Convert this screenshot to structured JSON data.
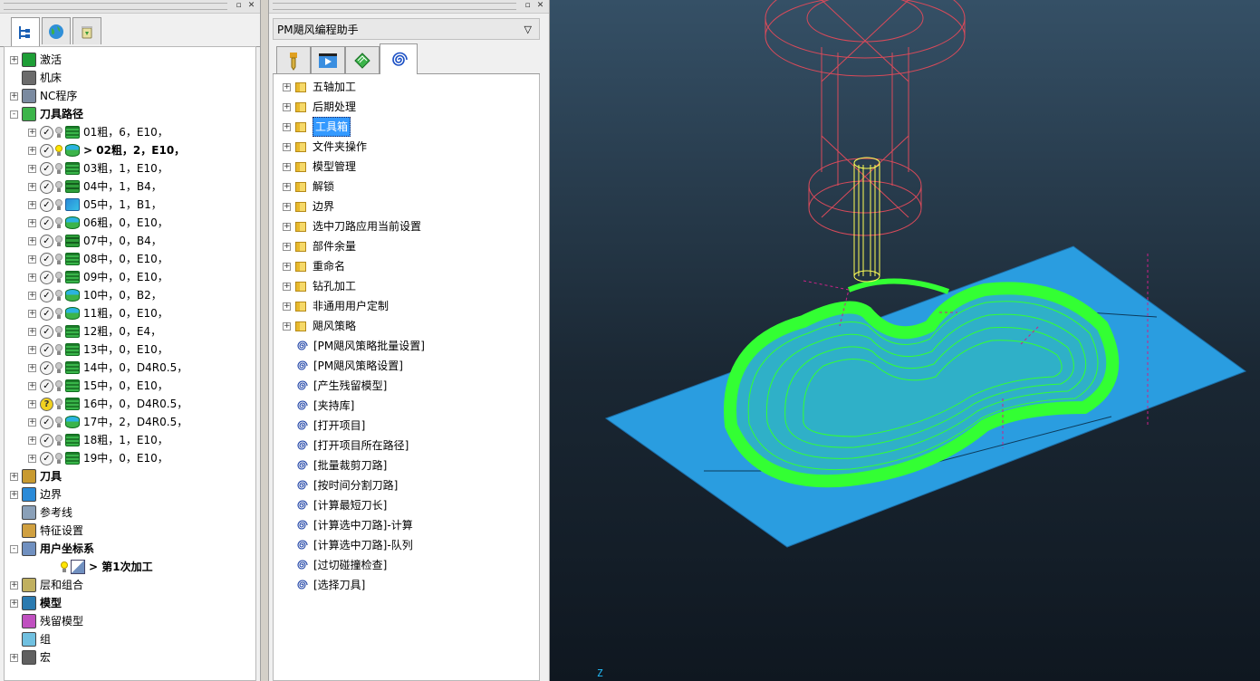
{
  "explorer": {
    "tree": [
      {
        "label": "激活",
        "bold": false,
        "icon": "activate-icon",
        "expander": "+"
      },
      {
        "label": "机床",
        "bold": false,
        "icon": "machine-icon",
        "expander": ""
      },
      {
        "label": "NC程序",
        "bold": false,
        "icon": "nc-program-icon",
        "expander": "+"
      },
      {
        "label": "刀具路径",
        "bold": true,
        "icon": "toolpaths-icon",
        "expander": "-"
      }
    ],
    "toolpaths": [
      {
        "label": "01粗，6，E10，",
        "status": "check",
        "bulb": false,
        "type": "layers",
        "active": false
      },
      {
        "label": "> 02粗，2，E10，",
        "status": "check",
        "bulb": true,
        "type": "cyl",
        "active": true
      },
      {
        "label": "03粗，1，E10，",
        "status": "check",
        "bulb": false,
        "type": "layers",
        "active": false
      },
      {
        "label": "04中，1，B4，",
        "status": "check",
        "bulb": false,
        "type": "flat",
        "active": false
      },
      {
        "label": "05中，1，B1，",
        "status": "check",
        "bulb": false,
        "type": "blue",
        "active": false
      },
      {
        "label": "06粗，0，E10，",
        "status": "check",
        "bulb": false,
        "type": "cyl",
        "active": false
      },
      {
        "label": "07中，0，B4，",
        "status": "check",
        "bulb": false,
        "type": "flat",
        "active": false
      },
      {
        "label": "08中，0，E10，",
        "status": "check",
        "bulb": false,
        "type": "layers",
        "active": false
      },
      {
        "label": "09中，0，E10，",
        "status": "check",
        "bulb": false,
        "type": "layers",
        "active": false
      },
      {
        "label": "10中，0，B2，",
        "status": "check",
        "bulb": false,
        "type": "cyl",
        "active": false
      },
      {
        "label": "11粗，0，E10，",
        "status": "check",
        "bulb": false,
        "type": "cyl",
        "active": false
      },
      {
        "label": "12粗，0，E4，",
        "status": "check",
        "bulb": false,
        "type": "layers",
        "active": false
      },
      {
        "label": "13中，0，E10，",
        "status": "check",
        "bulb": false,
        "type": "layers",
        "active": false
      },
      {
        "label": "14中，0，D4R0.5，",
        "status": "check",
        "bulb": false,
        "type": "layers",
        "active": false
      },
      {
        "label": "15中，0，E10，",
        "status": "check",
        "bulb": false,
        "type": "layers",
        "active": false
      },
      {
        "label": "16中，0，D4R0.5，",
        "status": "question",
        "bulb": false,
        "type": "layers",
        "active": false
      },
      {
        "label": "17中，2，D4R0.5，",
        "status": "check",
        "bulb": false,
        "type": "cyl",
        "active": false
      },
      {
        "label": "18粗，1，E10，",
        "status": "check",
        "bulb": false,
        "type": "layers",
        "active": false
      },
      {
        "label": "19中，0，E10，",
        "status": "check",
        "bulb": false,
        "type": "layers",
        "active": false
      }
    ],
    "tree_after": [
      {
        "label": "刀具",
        "bold": true,
        "icon": "tools-icon",
        "expander": "+"
      },
      {
        "label": "边界",
        "bold": false,
        "icon": "boundary-icon",
        "expander": "+"
      },
      {
        "label": "参考线",
        "bold": false,
        "icon": "pattern-icon",
        "expander": ""
      },
      {
        "label": "特征设置",
        "bold": false,
        "icon": "feature-icon",
        "expander": ""
      },
      {
        "label": "用户坐标系",
        "bold": true,
        "icon": "workplane-icon",
        "expander": "-"
      }
    ],
    "workplane_child": "> 第1次加工",
    "tree_tail": [
      {
        "label": "层和组合",
        "bold": false,
        "icon": "levels-icon",
        "expander": "+"
      },
      {
        "label": "模型",
        "bold": true,
        "icon": "model-icon",
        "expander": "+"
      },
      {
        "label": "残留模型",
        "bold": false,
        "icon": "stock-model-icon",
        "expander": ""
      },
      {
        "label": "组",
        "bold": false,
        "icon": "group-icon",
        "expander": ""
      },
      {
        "label": "宏",
        "bold": false,
        "icon": "macro-icon",
        "expander": "+"
      }
    ]
  },
  "assistant": {
    "title": "PM飓风编程助手",
    "dropdown": "▽",
    "folders": [
      "五轴加工",
      "后期处理",
      "工具箱",
      "文件夹操作",
      "模型管理",
      "解锁",
      "边界",
      "选中刀路应用当前设置",
      "部件余量",
      "重命名",
      "钻孔加工",
      "非通用用户定制",
      "飓风策略"
    ],
    "selected_folder": "工具箱",
    "commands": [
      "[PM飓风策略批量设置]",
      "[PM飓风策略设置]",
      "[产生残留模型]",
      "[夹持库]",
      "[打开项目]",
      "[打开项目所在路径]",
      "[批量裁剪刀路]",
      "[按时间分割刀路]",
      "[计算最短刀长]",
      "[计算选中刀路]-计算",
      "[计算选中刀路]-队列",
      "[过切碰撞检查]",
      "[选择刀具]"
    ]
  },
  "viewport": {
    "axis_label": "Z",
    "colors": {
      "stock": "#2a9de0",
      "toolpath": "#33ff33",
      "tool": "#ffff55",
      "holder": "#d94a5a"
    }
  },
  "colors": {
    "selection": "#3399ff"
  }
}
